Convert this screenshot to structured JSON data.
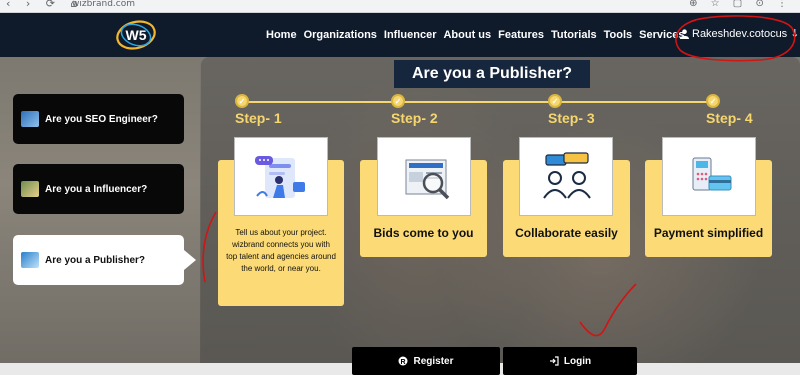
{
  "browser": {
    "nav_glyphs": "‹ › ⟳ ⌂",
    "url": "wizbrand.com",
    "tool_glyphs": "⊕ ☆ ▢ ⊙ ⋮"
  },
  "nav": {
    "items": [
      "Home",
      "Organizations",
      "Influencer",
      "About us",
      "Features",
      "Tutorials",
      "Tools",
      "Services"
    ],
    "user": "Rakeshdev.cotocus"
  },
  "sidebar": {
    "items": [
      {
        "label": "Are you SEO Engineer?",
        "active": false
      },
      {
        "label": "Are you a Influencer?",
        "active": false
      },
      {
        "label": "Are you a Publisher?",
        "active": true
      }
    ]
  },
  "main": {
    "title": "Are you a Publisher?",
    "steps": [
      "Step- 1",
      "Step- 2",
      "Step- 3",
      "Step- 4"
    ],
    "cards": [
      {
        "text": "Tell us about your project. wizbrand connects you with top talent and agencies around the world, or near you.",
        "icon": "project-illustration-icon"
      },
      {
        "text": "Bids come to you",
        "icon": "bids-document-icon"
      },
      {
        "text": "Collaborate easily",
        "icon": "collaborate-people-icon"
      },
      {
        "text": "Payment simplified",
        "icon": "payment-pos-icon"
      }
    ]
  },
  "buttons": {
    "register": "Register",
    "login": "Login"
  },
  "colors": {
    "accent": "#fcdb76",
    "navbar": "#0f1a2b",
    "title_bg": "#16263d"
  }
}
